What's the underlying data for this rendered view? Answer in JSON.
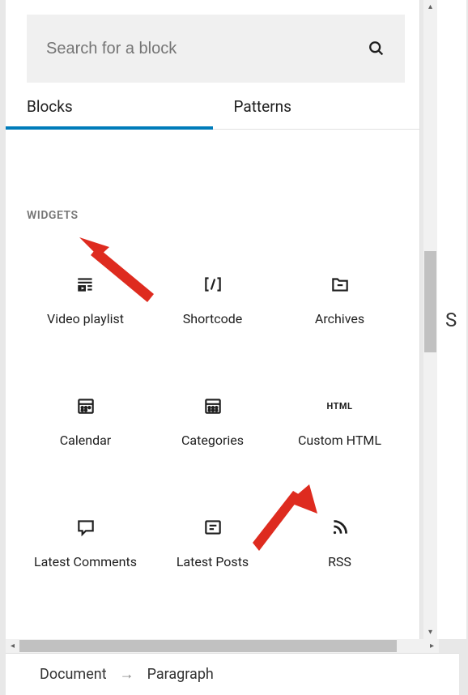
{
  "search": {
    "placeholder": "Search for a block"
  },
  "tabs": {
    "blocks": "Blocks",
    "patterns": "Patterns"
  },
  "section_title": "WIDGETS",
  "blocks": {
    "video_playlist": {
      "label": "Video playlist"
    },
    "shortcode": {
      "label": "Shortcode"
    },
    "archives": {
      "label": "Archives"
    },
    "calendar": {
      "label": "Calendar"
    },
    "categories": {
      "label": "Categories"
    },
    "custom_html": {
      "label": "Custom HTML",
      "badge": "HTML"
    },
    "latest_comments": {
      "label": "Latest Comments"
    },
    "latest_posts": {
      "label": "Latest Posts"
    },
    "rss": {
      "label": "RSS"
    }
  },
  "breadcrumb": {
    "document": "Document",
    "paragraph": "Paragraph"
  },
  "right_bg_text": "S"
}
